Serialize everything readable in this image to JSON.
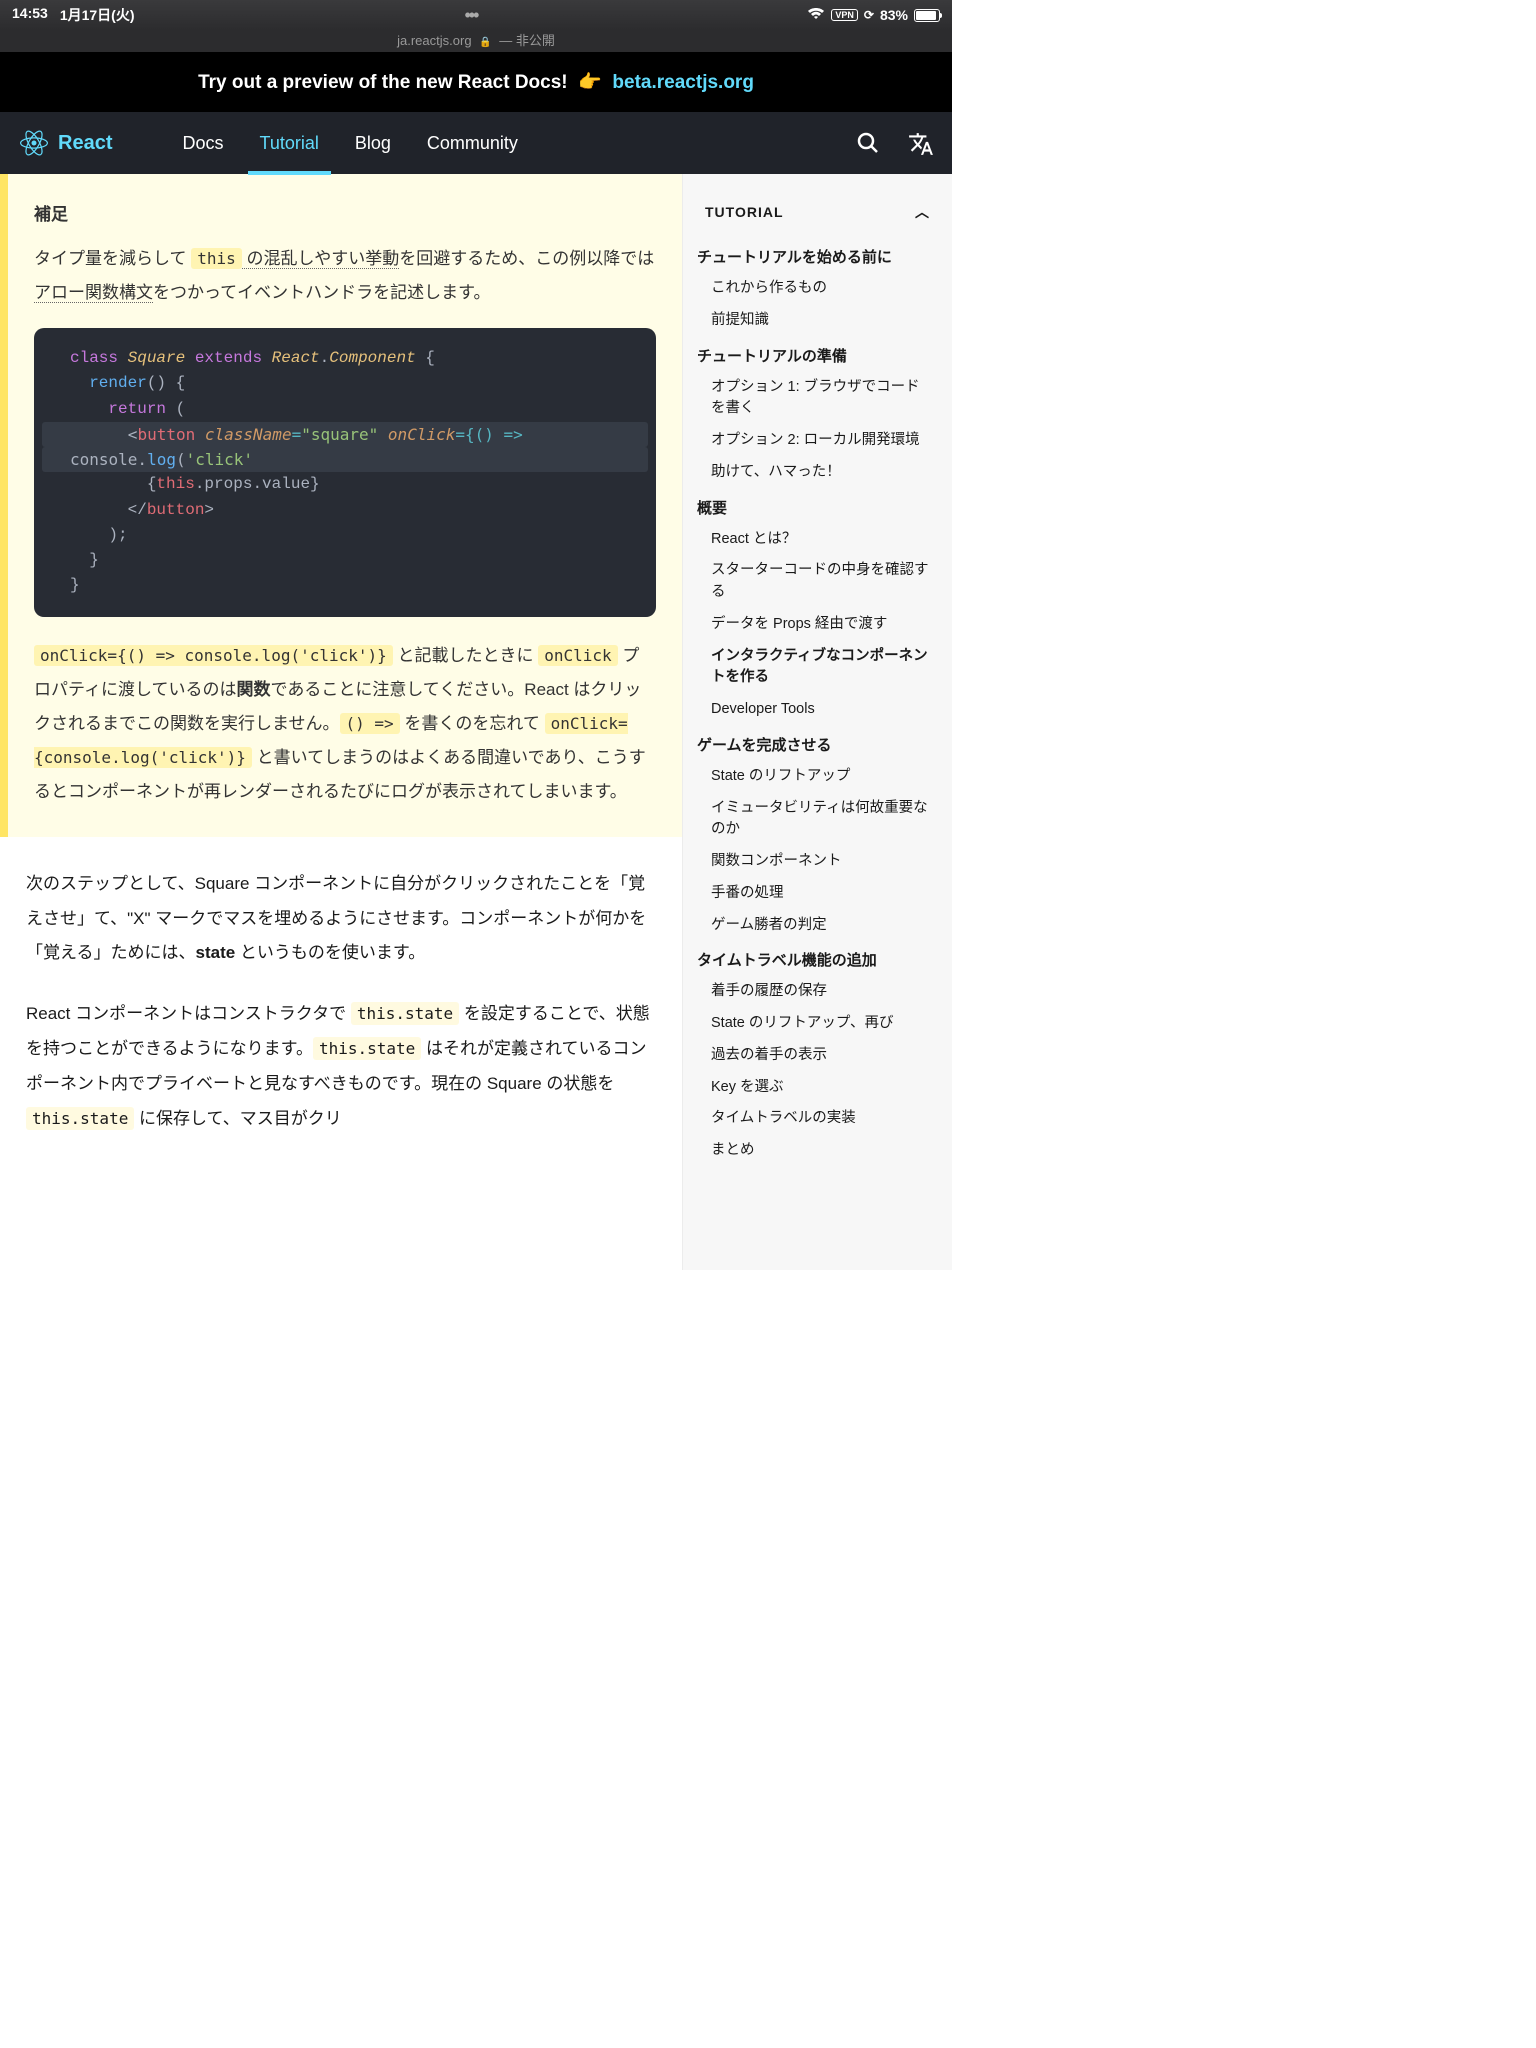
{
  "status": {
    "time": "14:53",
    "date": "1月17日(火)",
    "vpn": "VPN",
    "battery": "83%"
  },
  "url_bar": {
    "domain": "ja.reactjs.org",
    "privacy": " — 非公開"
  },
  "banner": {
    "text": "Try out a preview of the new React Docs!",
    "emoji": "👉",
    "link": "beta.reactjs.org"
  },
  "nav": {
    "brand": "React",
    "links": [
      "Docs",
      "Tutorial",
      "Blog",
      "Community"
    ],
    "active_index": 1
  },
  "note": {
    "heading": "補足",
    "p1a": "タイプ量を減らして ",
    "this_code": "this",
    "p1b": " の混乱しやすい挙動",
    "p1c": "を回避するため、この例以降では",
    "arrow_link": "アロー関数構文",
    "p1d": "をつかってイベントハンドラを記述します。",
    "p2a": "と記載したときに ",
    "onclick_code": "onClick",
    "p2b": " プロパティに渡しているのは",
    "p2bold": "関数",
    "p2c": "であることに注意してください。React はクリックされるまでこの関数を実行しません。",
    "p2code1": "onClick={() => console.log('click')}",
    "p2code2": "() =>",
    "p2d": " を書くのを忘れて ",
    "p2code3": "onClick={console.log('click')}",
    "p2e": " と書いてしまうのはよくある間違いであり、こうするとコンポーネントが再レンダーされるたびにログが表示されてしまいます。"
  },
  "code": {
    "l1": {
      "a": "class ",
      "b": "Square ",
      "c": "extends ",
      "d": "React",
      "e": ".",
      "f": "Component ",
      "g": "{"
    },
    "l2": {
      "a": "  ",
      "b": "render",
      "c": "() {"
    },
    "l3": {
      "a": "    ",
      "b": "return ",
      "c": "("
    },
    "l4": {
      "a": "      <",
      "b": "button ",
      "c": "className",
      "d": "=",
      "e": "\"square\"",
      "f": " ",
      "g": "onClick",
      "h": "={() =>"
    },
    "l5": {
      "a": "console.",
      "b": "log",
      "c": "(",
      "d": "'click'",
      "e": ")}>"
    },
    "l6": {
      "a": "        {",
      "b": "this",
      "c": ".props.value}"
    },
    "l7": {
      "a": "      </",
      "b": "button",
      "c": ">"
    },
    "l8": "    );",
    "l9": "  }",
    "l10": "}"
  },
  "body": {
    "p1a": "次のステップとして、Square コンポーネントに自分がクリックされたことを「覚えさせ」て、\"X\" マークでマスを埋めるようにさせます。コンポーネントが何かを「覚える」ためには、",
    "p1bold": "state",
    "p1b": " というものを使います。",
    "p2a": "React コンポーネントはコンストラクタで ",
    "p2code1": "this.state",
    "p2b": " を設定することで、状態を持つことができるようになります。",
    "p2code2": "this.state",
    "p2c": " はそれが定義されているコンポーネント内でプライベートと見なすべきものです。現在の Square の状態を ",
    "p2code3": "this.state",
    "p2d": " に保存して、マス目がクリ"
  },
  "sidebar": {
    "header": "TUTORIAL",
    "sections": [
      {
        "title": "チュートリアルを始める前に",
        "items": [
          "これから作るもの",
          "前提知識"
        ]
      },
      {
        "title": "チュートリアルの準備",
        "items": [
          "オプション 1: ブラウザでコードを書く",
          "オプション 2: ローカル開発環境",
          "助けて、ハマった！"
        ]
      },
      {
        "title": "概要",
        "items": [
          "React とは？",
          "スターターコードの中身を確認する",
          "データを Props 経由で渡す",
          "インタラクティブなコンポーネントを作る",
          "Developer Tools"
        ],
        "active_index": 3
      },
      {
        "title": "ゲームを完成させる",
        "items": [
          "State のリフトアップ",
          "イミュータビリティは何故重要なのか",
          "関数コンポーネント",
          "手番の処理",
          "ゲーム勝者の判定"
        ]
      },
      {
        "title": "タイムトラベル機能の追加",
        "items": [
          "着手の履歴の保存",
          "State のリフトアップ、再び",
          "過去の着手の表示",
          "Key を選ぶ",
          "タイムトラベルの実装",
          "まとめ"
        ]
      }
    ]
  }
}
